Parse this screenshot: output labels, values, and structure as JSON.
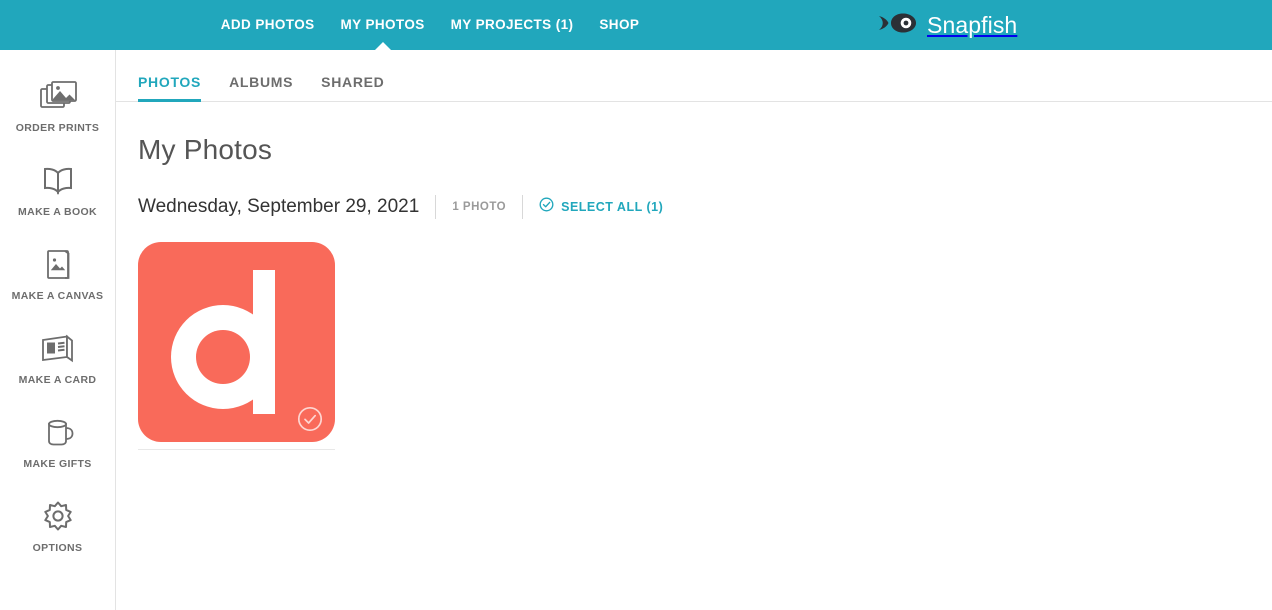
{
  "theme": {
    "teal": "#21a7bc",
    "coral": "#f96a5a",
    "text_gray": "#6d6d6d",
    "divider": "#e3e3e3"
  },
  "topbar": {
    "nav": [
      {
        "label": "ADD PHOTOS",
        "active": false
      },
      {
        "label": "MY PHOTOS",
        "active": true
      },
      {
        "label": "MY PROJECTS (1)",
        "active": false
      },
      {
        "label": "SHOP",
        "active": false
      }
    ],
    "brand": {
      "name": "Snapfish",
      "logo_icon": "fish-icon"
    }
  },
  "sidebar": {
    "items": [
      {
        "label": "ORDER PRINTS",
        "icon": "photos-stack-icon"
      },
      {
        "label": "MAKE A BOOK",
        "icon": "open-book-icon"
      },
      {
        "label": "MAKE A CANVAS",
        "icon": "canvas-frame-icon"
      },
      {
        "label": "MAKE A CARD",
        "icon": "greeting-card-icon"
      },
      {
        "label": "MAKE GIFTS",
        "icon": "mug-icon"
      },
      {
        "label": "OPTIONS",
        "icon": "gear-icon"
      }
    ]
  },
  "main": {
    "tabs": [
      {
        "label": "PHOTOS",
        "active": true
      },
      {
        "label": "ALBUMS",
        "active": false
      },
      {
        "label": "SHARED",
        "active": false
      }
    ],
    "page_title": "My Photos",
    "date_group": {
      "date": "Wednesday, September 29, 2021",
      "photo_count": "1 PHOTO",
      "select_all_label": "SELECT ALL (1)",
      "select_all_icon": "check-circle-icon"
    },
    "photos": [
      {
        "alt": "Orange app icon with white letter d",
        "background_color": "#f96a5a",
        "glyph": "d",
        "selected_icon": "check-circle-icon"
      }
    ]
  }
}
